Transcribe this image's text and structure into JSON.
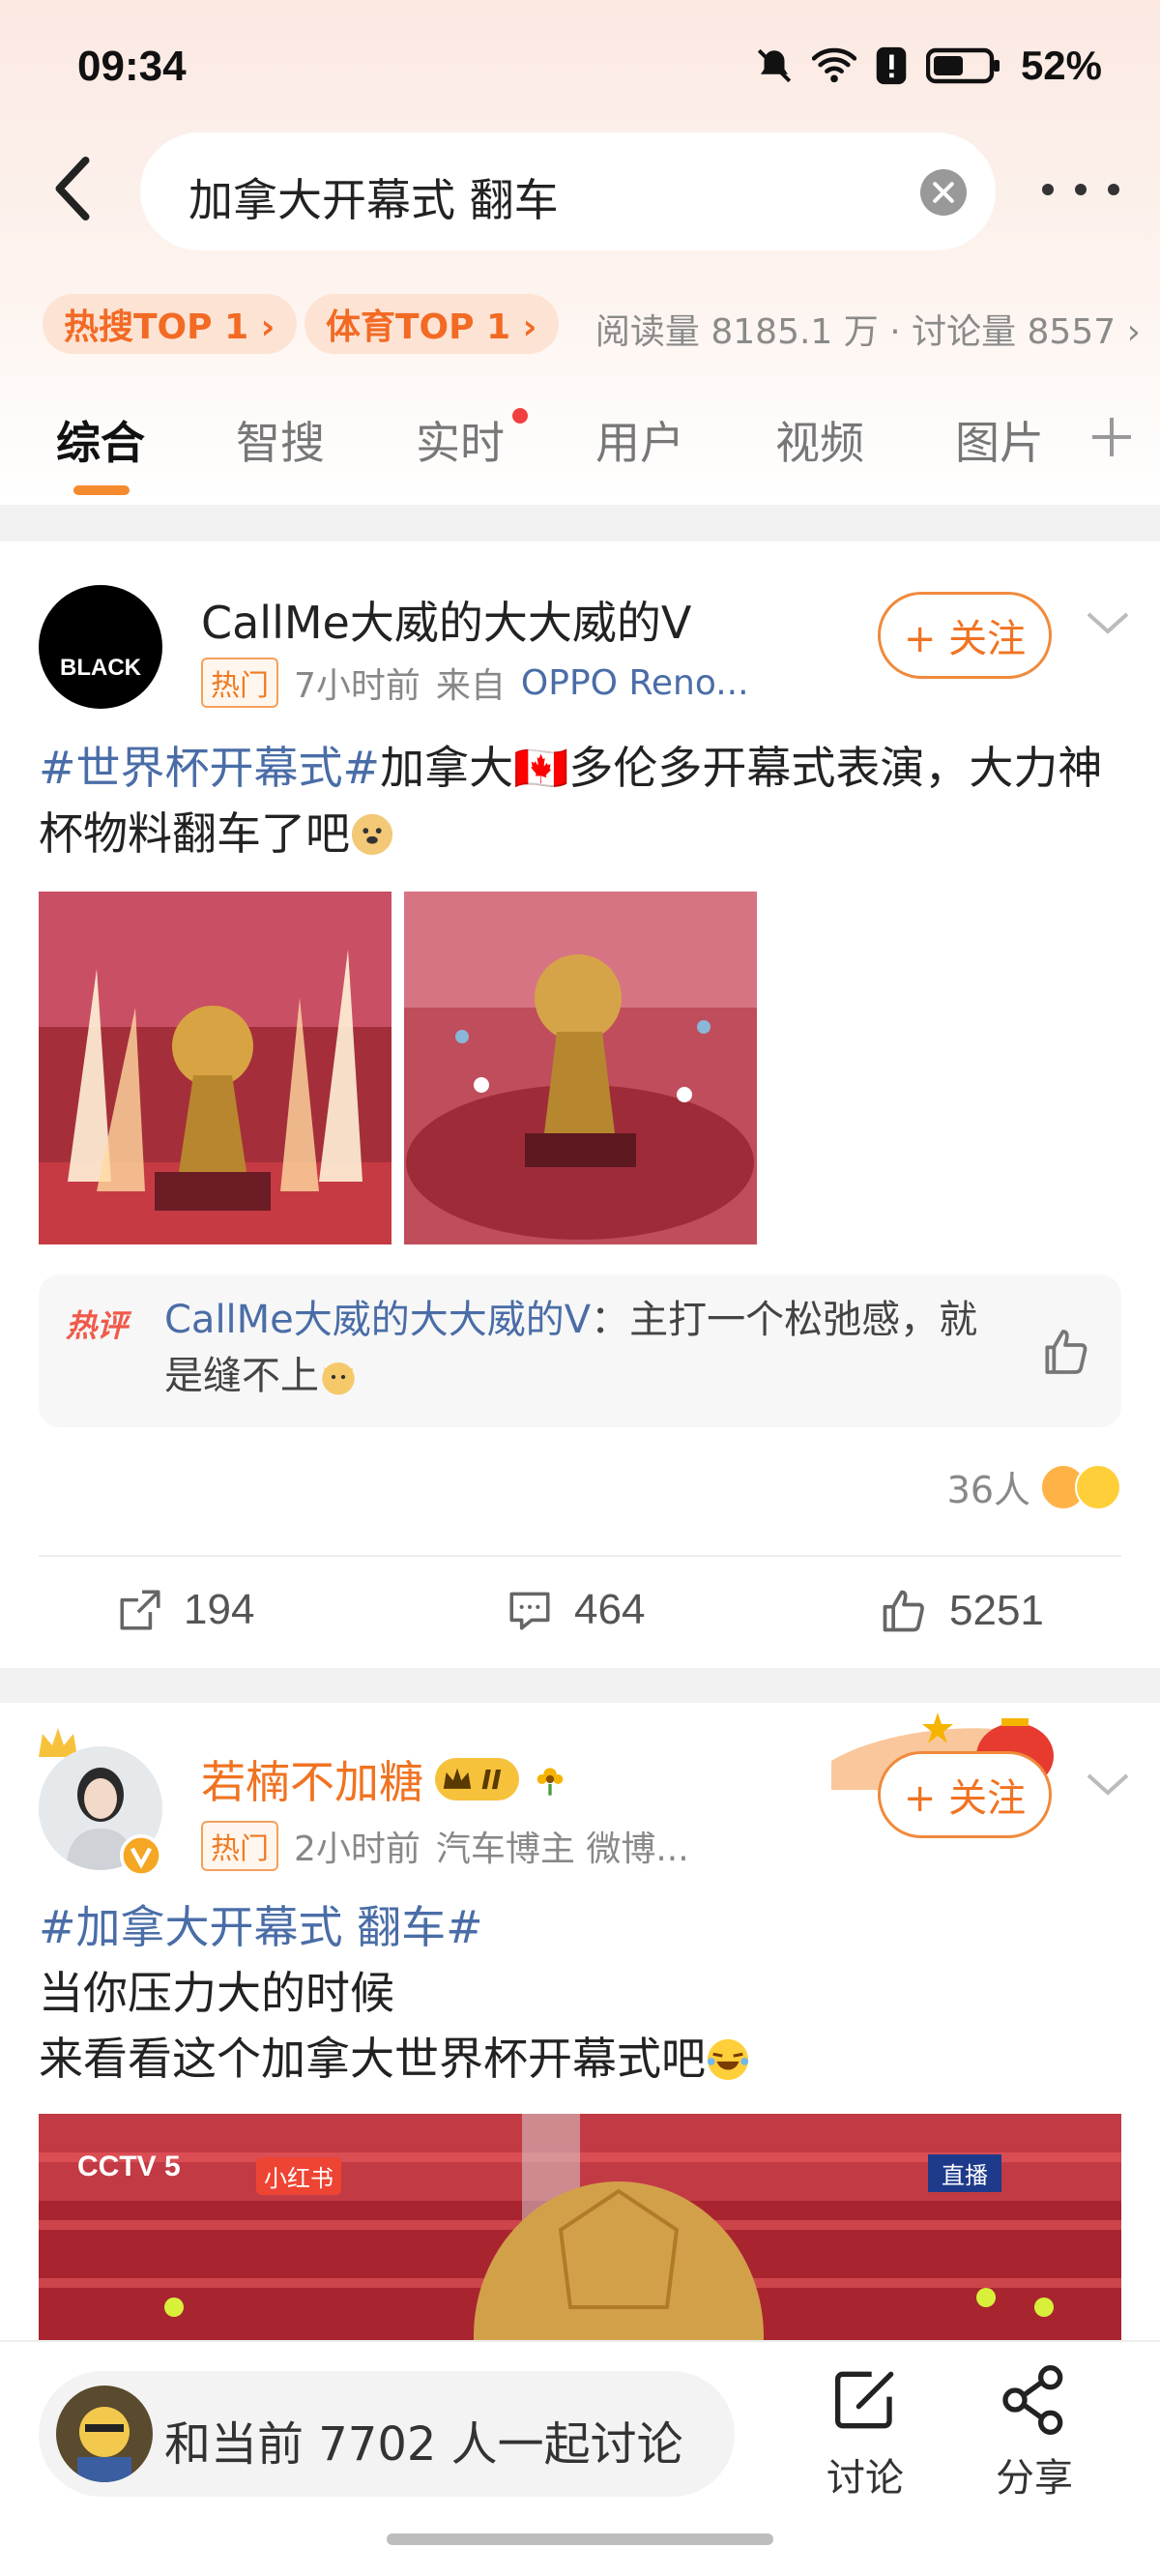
{
  "status_bar": {
    "time": "09:34",
    "battery": "52%"
  },
  "search": {
    "query": "加拿大开幕式 翻车"
  },
  "stats": {
    "badge_hot": "热搜TOP 1 ›",
    "badge_sports": "体育TOP 1 ›",
    "read_discuss": "阅读量 8185.1 万 · 讨论量 8557 ›"
  },
  "tabs": [
    {
      "label": "综合"
    },
    {
      "label": "智搜"
    },
    {
      "label": "实时"
    },
    {
      "label": "用户"
    },
    {
      "label": "视频"
    },
    {
      "label": "图片"
    }
  ],
  "post1": {
    "username": "CallMe大威的大大威的V",
    "avatar_text": "BLACK",
    "hot_tag": "热门",
    "time": "7小时前",
    "source_prefix": "来自",
    "source": "OPPO Reno...",
    "follow": "+ 关注",
    "topic": "#世界杯开幕式#",
    "text_a": "加拿大",
    "flag": "🇨🇦",
    "text_b": "多伦多开幕式表演，大力神杯物料翻车了吧",
    "hot_comment_label": "热评",
    "hot_comment_user": "CallMe大威的大大威的V",
    "hot_comment_text": "：主打一个松弛感，就是缝不上",
    "likers": "36人",
    "reposts": "194",
    "comments": "464",
    "likes": "5251"
  },
  "post2": {
    "username": "若楠不加糖",
    "level": "II",
    "hot_tag": "热门",
    "time": "2小时前",
    "meta_extra": "汽车博主 微博...",
    "follow": "+ 关注",
    "topic": "#加拿大开幕式 翻车#",
    "line1": "当你压力大的时候",
    "line2": "来看看这个加拿大世界杯开幕式吧",
    "video_logo": "CCTV 5",
    "video_tag1": "小红书",
    "video_tag2": "直播"
  },
  "bottom": {
    "discuss": "和当前 7702 人一起讨论",
    "comment_label": "讨论",
    "share_label": "分享"
  },
  "colors": {
    "accent": "#f58a2f",
    "topic": "#4a6da7",
    "hot": "#f26a24"
  }
}
